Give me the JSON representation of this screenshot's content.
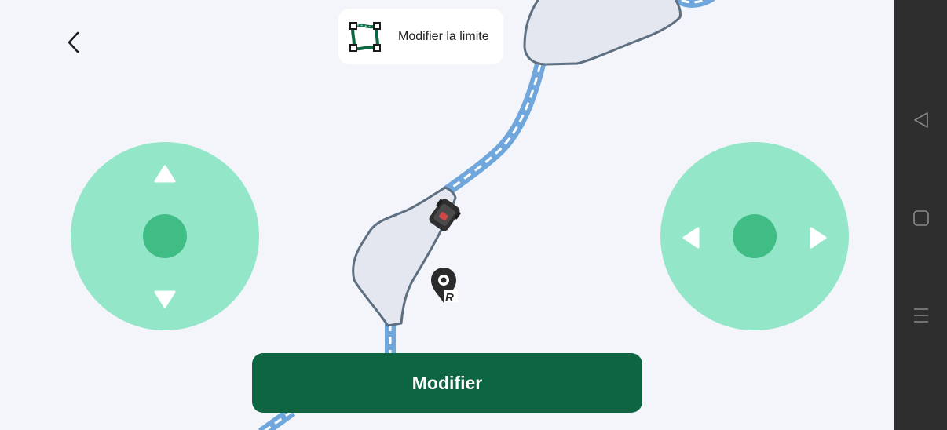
{
  "header": {
    "mode_label": "Modifier la limite",
    "back_icon": "chevron-left-icon",
    "mode_icon": "boundary-edit-icon"
  },
  "map": {
    "robot_icon": "mower-icon",
    "station_icon": "charging-station-pin-icon",
    "station_letter": "R"
  },
  "joysticks": {
    "left": {
      "name": "forward-backward",
      "arrows": [
        "arrow-up-icon",
        "arrow-down-icon"
      ]
    },
    "right": {
      "name": "left-right",
      "arrows": [
        "arrow-left-icon",
        "arrow-right-icon"
      ]
    }
  },
  "actions": {
    "modify_label": "Modifier"
  },
  "system_nav": {
    "icons": [
      "nav-back-icon",
      "nav-home-icon",
      "nav-menu-icon"
    ]
  },
  "colors": {
    "background": "#f4f5fa",
    "zone_fill": "#e4e7ef",
    "zone_stroke": "#5d6f80",
    "path": "#6fa7dc",
    "joystick": "#93e6c7",
    "joystick_knob": "#3fbd85",
    "primary_button": "#0e6541",
    "navbar": "#2e2e2e"
  }
}
